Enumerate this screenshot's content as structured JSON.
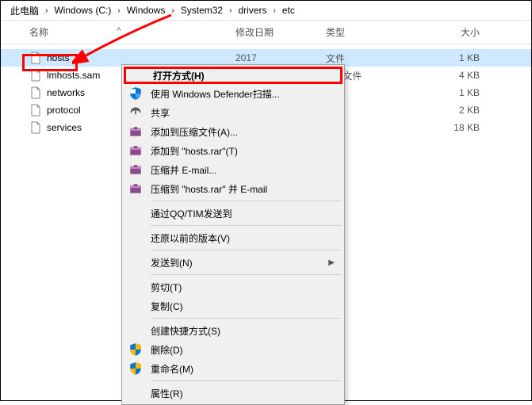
{
  "breadcrumb": [
    "此电脑",
    "Windows (C:)",
    "Windows",
    "System32",
    "drivers",
    "etc"
  ],
  "headers": {
    "name": "名称",
    "date": "修改日期",
    "type": "类型",
    "size": "大小"
  },
  "files": [
    {
      "name": "hosts",
      "date": "2017",
      "type": "文件",
      "size": "1 KB",
      "selected": true
    },
    {
      "name": "lmhosts.sam",
      "date": "",
      "type": "AM 文件",
      "size": "4 KB"
    },
    {
      "name": "networks",
      "date": "",
      "type": "件",
      "size": "1 KB"
    },
    {
      "name": "protocol",
      "date": "",
      "type": "件",
      "size": "2 KB"
    },
    {
      "name": "services",
      "date": "",
      "type": "件",
      "size": "18 KB"
    }
  ],
  "menu": {
    "openwith": "打开方式(H)",
    "defender": "使用 Windows Defender扫描...",
    "share": "共享",
    "addzip": "添加到压缩文件(A)...",
    "addrar": "添加到 \"hosts.rar\"(T)",
    "zipmail": "压缩并 E-mail...",
    "zipmailrar": "压缩到 \"hosts.rar\" 并 E-mail",
    "qq": "通过QQ/TIM发送到",
    "restore": "还原以前的版本(V)",
    "sendto": "发送到(N)",
    "cut": "剪切(T)",
    "copy": "复制(C)",
    "shortcut": "创建快捷方式(S)",
    "delete": "删除(D)",
    "rename": "重命名(M)",
    "props": "属性(R)"
  }
}
